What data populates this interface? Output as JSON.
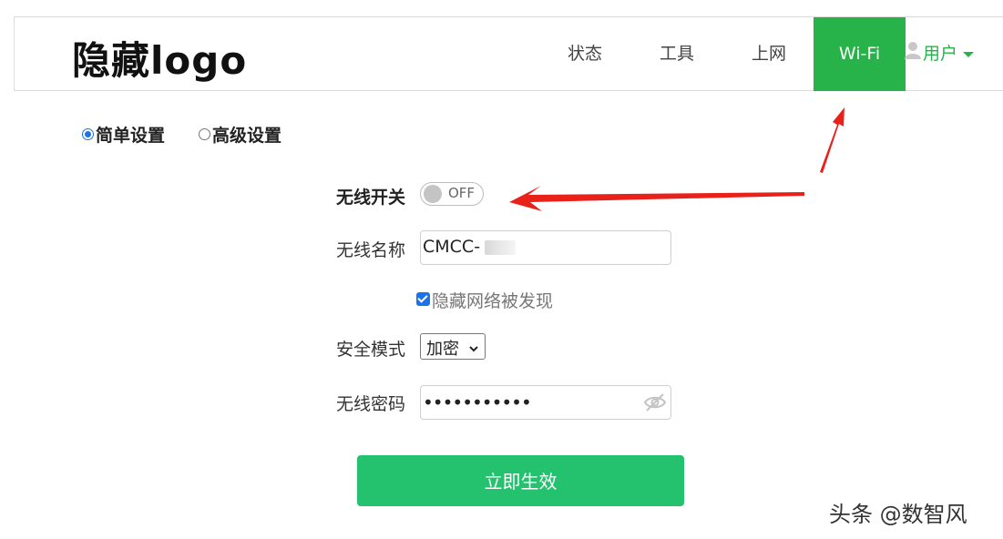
{
  "header": {
    "logo": "隐藏logo",
    "nav": [
      {
        "label": "状态"
      },
      {
        "label": "工具"
      },
      {
        "label": "上网"
      },
      {
        "label": "Wi-Fi",
        "active": true
      }
    ],
    "user_menu": {
      "label": "用户",
      "icon": "user-icon"
    }
  },
  "mode": {
    "simple": {
      "label": "简单设置",
      "checked": true
    },
    "advanced": {
      "label": "高级设置",
      "checked": false
    }
  },
  "form": {
    "wifi_switch": {
      "label": "无线开关",
      "state": "OFF"
    },
    "ssid": {
      "label": "无线名称",
      "value": "CMCC-"
    },
    "hide_network": {
      "label": "隐藏网络被发现",
      "checked": true
    },
    "security": {
      "label": "安全模式",
      "value": "加密"
    },
    "password": {
      "label": "无线密码",
      "value": "•••••••••••",
      "icon": "eye-off-icon"
    },
    "submit_label": "立即生效"
  },
  "watermark": "头条 @数智风",
  "colors": {
    "brand_green": "#27b34a",
    "button_green": "#24c26e",
    "annotation_red": "#e8221b"
  }
}
